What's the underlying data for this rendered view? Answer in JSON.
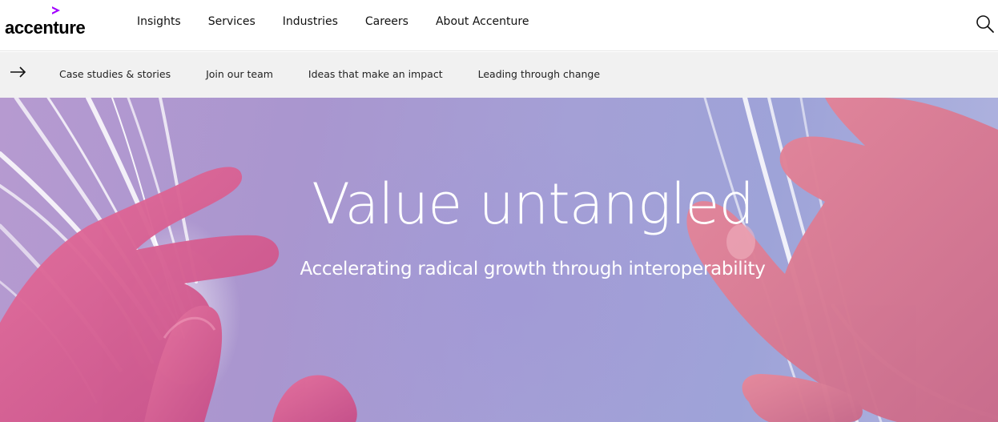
{
  "brand": {
    "name": "accenture",
    "accent_color": "#a100ff"
  },
  "topnav": {
    "items": [
      "Insights",
      "Services",
      "Industries",
      "Careers",
      "About Accenture"
    ],
    "search_icon": "search-icon"
  },
  "subnav": {
    "arrow_icon": "arrow-right-icon",
    "items": [
      "Case studies & stories",
      "Join our team",
      "Ideas that make an impact",
      "Leading through change"
    ]
  },
  "hero": {
    "title": "Value untangled",
    "subtitle": "Accelerating radical growth through interoperability",
    "image": "hands-with-light-fibers-image"
  }
}
